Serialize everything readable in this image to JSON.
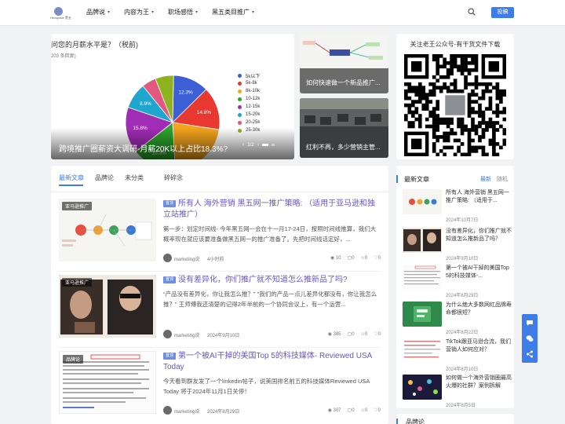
{
  "header": {
    "logo_text": "Hexspace 黑五",
    "nav": [
      {
        "label": "品牌说",
        "has_dropdown": true
      },
      {
        "label": "内容为王",
        "has_dropdown": true
      },
      {
        "label": "职场感悟",
        "has_dropdown": true
      },
      {
        "label": "黑五类目推广",
        "has_dropdown": true
      }
    ],
    "post_button": "投稿"
  },
  "hero": {
    "poll_title": "问您的月薪水平是？（税前)",
    "poll_count": "203 条回复)",
    "caption": "跨境推广圈薪资大调研-月薪20K以上占比18.3%?",
    "pager": "1/2",
    "prev_arrow": "‹",
    "next_arrow": "›"
  },
  "chart_data": {
    "type": "pie",
    "title": "问您的月薪水平是？（税前)",
    "categories": [
      "5k以下",
      "5k-8k",
      "8k-10k",
      "10-12k",
      "12-15k",
      "15-20k",
      "20-25k",
      "25-30k"
    ],
    "colors": [
      "#3c5fd6",
      "#e8382f",
      "#f3a41d",
      "#2ca62c",
      "#a12cb6",
      "#1ea6cf",
      "#e3587e",
      "#8fb21f"
    ],
    "values": [
      12.3,
      14.8,
      21.7,
      15.3,
      15.8,
      8.9,
      4.9,
      6.3
    ],
    "data_labels": [
      "12.3%",
      "14.8%",
      "21.7%",
      "15.3%",
      "15.8%",
      "8.9%",
      "",
      ""
    ],
    "legend_position": "right"
  },
  "thumbs": [
    {
      "caption": "如何快速做一个新品推广..."
    },
    {
      "caption": "红利不再，多少营销主管..."
    }
  ],
  "qr": {
    "title": "关注老王公众号-有干货文件下载"
  },
  "tabs": [
    {
      "label": "最新文章",
      "active": true
    },
    {
      "label": "品牌论",
      "active": false
    },
    {
      "label": "未分类",
      "active": false
    },
    {
      "label": "碎碎念",
      "active": false
    }
  ],
  "articles": [
    {
      "tag": "亚马逊推广",
      "badge": "置顶",
      "title": "所有人 海外营销 黑五网一推广策略: （适用于亚马逊和独立站推广）",
      "excerpt": "第一步：划定时间线- 今年黑五网一会在十一月17-24日，按照时间线推算，我们大概率现在就应该要准备做黑五网一的推广准备了。先把时间线话定好，...",
      "author": "marketing说",
      "date": "4小时前",
      "views": "10",
      "comments": "0",
      "stars": "0",
      "likes": "0"
    },
    {
      "tag": "亚马逊推广",
      "badge": "置顶",
      "title": "没有差异化，你们推广就不知道怎么推新品了吗?",
      "excerpt": "“产品没有差异化，你让我怎么推？” \"我们的产品一点儿差异化都没有，你让我怎么推？\" 王师傅我还清楚的记得2年半前的一个协同会议上，有一个运营...",
      "author": "marketing说",
      "date": "2024年9月10日",
      "views": "385",
      "comments": "0",
      "stars": "0",
      "likes": "0"
    },
    {
      "tag": "品牌论",
      "badge": "置顶",
      "title": "第一个被AI干掉的美国Top 5的科技媒体- Reviewed USA Today",
      "excerpt": "今天看到群友发了一个linkedin帖子，说美国排名前五的科技媒体Reviewed USA Today 将于2024年11月1日关停！",
      "author": "marketing说",
      "date": "2024年8月29日",
      "views": "307",
      "comments": "0",
      "stars": "0",
      "likes": "0"
    }
  ],
  "sidebar": {
    "title": "最新文章",
    "switch_on": "最新",
    "switch_off": "随机",
    "items": [
      {
        "title": "所有人 海外营销 黑五网一推广策略: （适用于...",
        "date": "2024年10月7日"
      },
      {
        "title": "没有差异化，你们推广就不知道怎么推新品了吗？",
        "date": "2024年9月10日"
      },
      {
        "title": "第一个被AI干掉的美国Top 5的科技媒体-...",
        "date": "2024年8月29日"
      },
      {
        "title": "为什么绝大多数网红品牌寿命都很短？",
        "date": "2024年8月22日"
      },
      {
        "title": "TikTok跟亚马逊合流，我们营销人如何应对？",
        "date": "2024年8月10日"
      },
      {
        "title": "如何做一个海外营销圈最高火爆的社群？案例拆解",
        "date": "2024年8月5日"
      }
    ]
  },
  "sidebar2": {
    "title": "品牌论"
  }
}
